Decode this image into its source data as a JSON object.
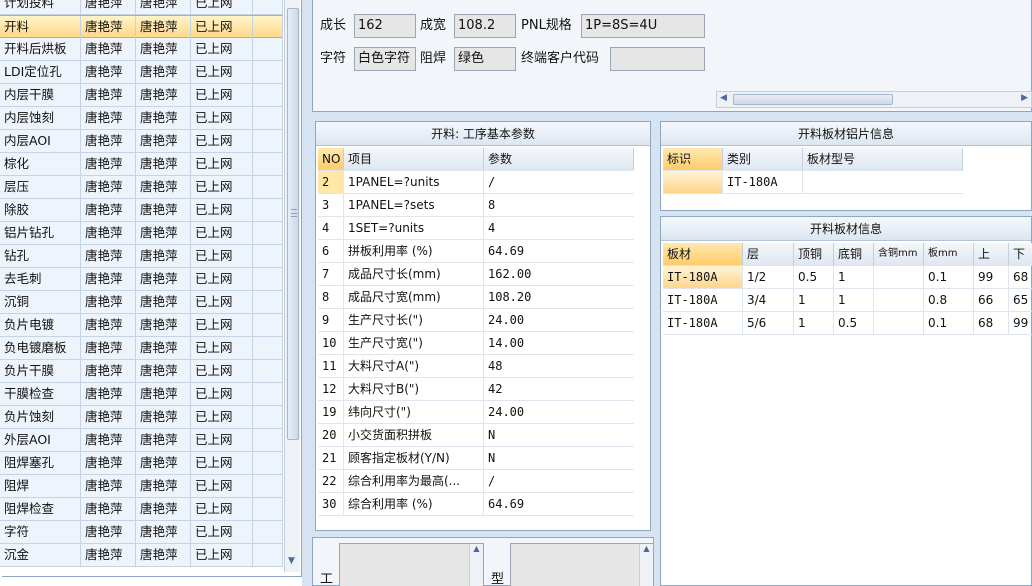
{
  "process_list": {
    "rows": [
      {
        "name": "计划投料",
        "c1": "唐艳萍",
        "c2": "唐艳萍",
        "c3": "已上网",
        "selected": false
      },
      {
        "name": "开料",
        "c1": "唐艳萍",
        "c2": "唐艳萍",
        "c3": "已上网",
        "selected": true
      },
      {
        "name": "开料后烘板",
        "c1": "唐艳萍",
        "c2": "唐艳萍",
        "c3": "已上网",
        "selected": false
      },
      {
        "name": "LDI定位孔",
        "c1": "唐艳萍",
        "c2": "唐艳萍",
        "c3": "已上网",
        "selected": false
      },
      {
        "name": "内层干膜",
        "c1": "唐艳萍",
        "c2": "唐艳萍",
        "c3": "已上网",
        "selected": false
      },
      {
        "name": "内层蚀刻",
        "c1": "唐艳萍",
        "c2": "唐艳萍",
        "c3": "已上网",
        "selected": false
      },
      {
        "name": "内层AOI",
        "c1": "唐艳萍",
        "c2": "唐艳萍",
        "c3": "已上网",
        "selected": false
      },
      {
        "name": "棕化",
        "c1": "唐艳萍",
        "c2": "唐艳萍",
        "c3": "已上网",
        "selected": false
      },
      {
        "name": "层压",
        "c1": "唐艳萍",
        "c2": "唐艳萍",
        "c3": "已上网",
        "selected": false
      },
      {
        "name": "除胶",
        "c1": "唐艳萍",
        "c2": "唐艳萍",
        "c3": "已上网",
        "selected": false
      },
      {
        "name": "铝片钻孔",
        "c1": "唐艳萍",
        "c2": "唐艳萍",
        "c3": "已上网",
        "selected": false
      },
      {
        "name": "钻孔",
        "c1": "唐艳萍",
        "c2": "唐艳萍",
        "c3": "已上网",
        "selected": false
      },
      {
        "name": "去毛刺",
        "c1": "唐艳萍",
        "c2": "唐艳萍",
        "c3": "已上网",
        "selected": false
      },
      {
        "name": "沉铜",
        "c1": "唐艳萍",
        "c2": "唐艳萍",
        "c3": "已上网",
        "selected": false
      },
      {
        "name": "负片电镀",
        "c1": "唐艳萍",
        "c2": "唐艳萍",
        "c3": "已上网",
        "selected": false
      },
      {
        "name": "负电镀磨板",
        "c1": "唐艳萍",
        "c2": "唐艳萍",
        "c3": "已上网",
        "selected": false
      },
      {
        "name": "负片干膜",
        "c1": "唐艳萍",
        "c2": "唐艳萍",
        "c3": "已上网",
        "selected": false
      },
      {
        "name": "干膜检查",
        "c1": "唐艳萍",
        "c2": "唐艳萍",
        "c3": "已上网",
        "selected": false
      },
      {
        "name": "负片蚀刻",
        "c1": "唐艳萍",
        "c2": "唐艳萍",
        "c3": "已上网",
        "selected": false
      },
      {
        "name": "外层AOI",
        "c1": "唐艳萍",
        "c2": "唐艳萍",
        "c3": "已上网",
        "selected": false
      },
      {
        "name": "阻焊塞孔",
        "c1": "唐艳萍",
        "c2": "唐艳萍",
        "c3": "已上网",
        "selected": false
      },
      {
        "name": "阻焊",
        "c1": "唐艳萍",
        "c2": "唐艳萍",
        "c3": "已上网",
        "selected": false
      },
      {
        "name": "阻焊检查",
        "c1": "唐艳萍",
        "c2": "唐艳萍",
        "c3": "已上网",
        "selected": false
      },
      {
        "name": "字符",
        "c1": "唐艳萍",
        "c2": "唐艳萍",
        "c3": "已上网",
        "selected": false
      },
      {
        "name": "沉金",
        "c1": "唐艳萍",
        "c2": "唐艳萍",
        "c3": "已上网",
        "selected": false
      }
    ]
  },
  "info": {
    "length_label": "成长",
    "length_value": "162",
    "width_label": "成宽",
    "width_value": "108.2",
    "pnl_label": "PNL规格",
    "pnl_value": "1P=8S=4U",
    "char_label": "字符",
    "char_value": "白色字符",
    "mask_label": "阻焊",
    "mask_value": "绿色",
    "cust_label": "终端客户代码",
    "cust_value": ""
  },
  "params": {
    "title": "开料: 工序基本参数",
    "headers": {
      "no": "NO",
      "item": "项目",
      "value": "参数"
    },
    "rows": [
      {
        "no": "2",
        "item": "1PANEL=?units",
        "value": "/"
      },
      {
        "no": "3",
        "item": "1PANEL=?sets",
        "value": "8"
      },
      {
        "no": "4",
        "item": "1SET=?units",
        "value": "4"
      },
      {
        "no": "6",
        "item": "拼板利用率 (%)",
        "value": "64.69"
      },
      {
        "no": "7",
        "item": "成品尺寸长(mm)",
        "value": "162.00"
      },
      {
        "no": "8",
        "item": "成品尺寸宽(mm)",
        "value": "108.20"
      },
      {
        "no": "9",
        "item": "生产尺寸长(\")",
        "value": "24.00"
      },
      {
        "no": "10",
        "item": "生产尺寸宽(\")",
        "value": "14.00"
      },
      {
        "no": "11",
        "item": "大料尺寸A(\")",
        "value": "48"
      },
      {
        "no": "12",
        "item": "大料尺寸B(\")",
        "value": "42"
      },
      {
        "no": "19",
        "item": "纬向尺寸(\")",
        "value": "24.00"
      },
      {
        "no": "20",
        "item": "小交货面积拼板",
        "value": "N"
      },
      {
        "no": "21",
        "item": "顾客指定板材(Y/N)",
        "value": "N"
      },
      {
        "no": "22",
        "item": "综合利用率为最高(...",
        "value": "/"
      },
      {
        "no": "30",
        "item": "综合利用率 (%)",
        "value": "64.69"
      }
    ]
  },
  "bottom": {
    "label_a": "工",
    "label_b": "型"
  },
  "aluminum": {
    "title": "开料板材铝片信息",
    "headers": {
      "mark": "标识",
      "category": "类别",
      "model": "板材型号"
    },
    "rows": [
      {
        "mark": "",
        "category": "IT-180A",
        "model": ""
      }
    ]
  },
  "sheet": {
    "title": "开料板材信息",
    "headers": {
      "material": "板材",
      "layer": "层",
      "top_cu": "顶铜",
      "bot_cu": "底铜",
      "incl_cu": "含铜mm",
      "thick": "板mm",
      "up": "上",
      "down": "下"
    },
    "rows": [
      {
        "material": "IT-180A",
        "layer": "1/2",
        "top_cu": "0.5",
        "bot_cu": "1",
        "incl_cu": "",
        "thick": "0.1",
        "up": "99",
        "down": "68"
      },
      {
        "material": "IT-180A",
        "layer": "3/4",
        "top_cu": "1",
        "bot_cu": "1",
        "incl_cu": "",
        "thick": "0.8",
        "up": "66",
        "down": "65"
      },
      {
        "material": "IT-180A",
        "layer": "5/6",
        "top_cu": "1",
        "bot_cu": "0.5",
        "incl_cu": "",
        "thick": "0.1",
        "up": "68",
        "down": "99"
      }
    ]
  }
}
